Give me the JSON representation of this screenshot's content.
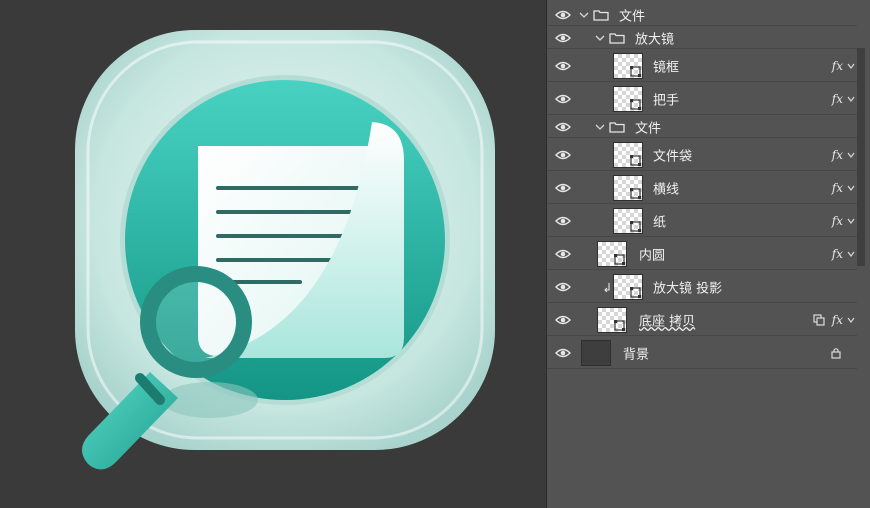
{
  "layers": [
    {
      "name": "文件",
      "kind": "group",
      "depth": 0,
      "visible": true
    },
    {
      "name": "放大镜",
      "kind": "group",
      "depth": 1,
      "visible": true
    },
    {
      "name": "镜框",
      "kind": "shape",
      "depth": 2,
      "fx": "fx",
      "visible": true
    },
    {
      "name": "把手",
      "kind": "shape",
      "depth": 2,
      "fx": "fx",
      "visible": true
    },
    {
      "name": "文件",
      "kind": "group",
      "depth": 1,
      "visible": true
    },
    {
      "name": "文件袋",
      "kind": "shape",
      "depth": 2,
      "fx": "fx",
      "visible": true
    },
    {
      "name": "横线",
      "kind": "shape",
      "depth": 2,
      "fx": "fx",
      "visible": true
    },
    {
      "name": "纸",
      "kind": "shape",
      "depth": 2,
      "fx": "fx",
      "visible": true
    },
    {
      "name": "内圆",
      "kind": "shape",
      "depth": 1,
      "fx": "fx",
      "visible": true
    },
    {
      "name": "放大镜 投影",
      "kind": "shape",
      "depth": 2,
      "clipped": true,
      "visible": true
    },
    {
      "name": "底座 拷贝",
      "kind": "smart",
      "depth": 1,
      "fx": "fx",
      "visible": true
    },
    {
      "name": "背景",
      "kind": "background",
      "depth": 0,
      "locked": true,
      "visible": true
    }
  ],
  "icons": {
    "eye": "eye-icon",
    "folder": "folder-icon",
    "fx": "fx-icon",
    "lock": "lock-icon"
  },
  "colors": {
    "canvas_bg": "#3a3a3a",
    "panel_bg": "#535353",
    "icon_outer": "#cfe9e4",
    "icon_inner": "#1fa898",
    "magnifier": "#2a8d82"
  }
}
